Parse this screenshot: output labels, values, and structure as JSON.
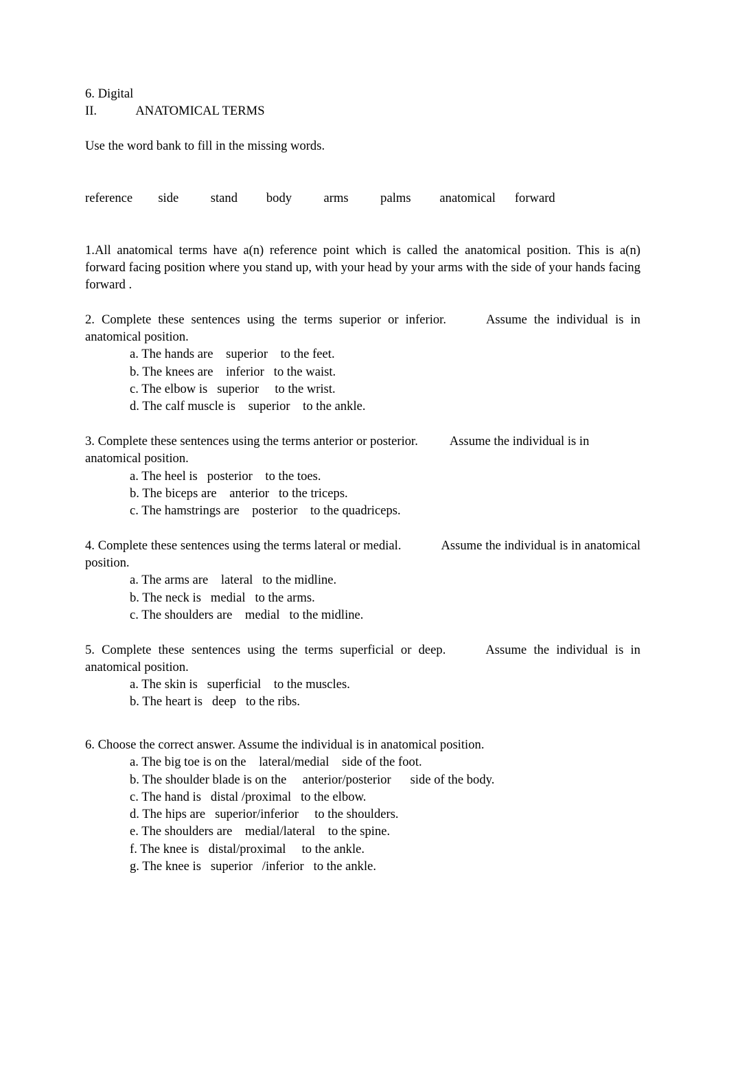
{
  "document": {
    "preceding_item": "6. Digital",
    "section": {
      "numeral": "II.",
      "title": "ANATOMICAL TERMS"
    },
    "instruction": "Use the word bank to fill in the missing words.",
    "word_bank": {
      "words": [
        "reference",
        "side",
        "stand",
        "body",
        "arms",
        "palms",
        "anatomical",
        "forward"
      ],
      "line": "reference        side          stand         body          arms          palms         anatomical      forward"
    },
    "questions": [
      {
        "number": "1.",
        "prompt": "1.All anatomical terms have a(n)     reference    point which is called the    anatomical     position. This is a(n)  forward   facing position where you    stand   up, with your  head  by your  arms   with the side of your hands facing   forward  .",
        "subitems": []
      },
      {
        "number": "2.",
        "prompt_main": "2. Complete these sentences using the terms superior or inferior.",
        "prompt_tail": "Assume the individual is in anatomical position.",
        "subitems": [
          "a. The hands are    superior    to the feet.",
          "b. The knees are    inferior   to the waist.",
          "c. The elbow is   superior     to the wrist.",
          "d. The calf muscle is    superior    to the ankle."
        ]
      },
      {
        "number": "3.",
        "prompt_main": "3. Complete these sentences using the terms anterior or posterior.",
        "prompt_tail": "Assume the individual is in anatomical position.",
        "subitems": [
          "a. The heel is   posterior    to the toes.",
          "b. The biceps are    anterior   to the triceps.",
          "c. The hamstrings are    posterior    to the quadriceps."
        ]
      },
      {
        "number": "4.",
        "prompt_main": "4. Complete these sentences using the terms lateral or medial.",
        "prompt_tail": "Assume the individual is in anatomical position.",
        "subitems": [
          "a. The arms are    lateral   to the midline.",
          "b. The neck is   medial   to the arms.",
          "c. The shoulders are    medial   to the midline."
        ]
      },
      {
        "number": "5.",
        "prompt_main": "5. Complete these sentences using the terms superficial or deep.",
        "prompt_tail": "Assume the individual is in anatomical position.",
        "subitems": [
          "a. The skin is   superficial    to the muscles.",
          "b. The heart is   deep   to the ribs."
        ]
      },
      {
        "number": "6.",
        "prompt_main": "6. Choose the correct answer. Assume the individual is in anatomical position.",
        "prompt_tail": "",
        "subitems": [
          "a. The big toe is on the    lateral/medial    side of the foot.",
          "b. The shoulder blade is on the     anterior/posterior      side of the body.",
          "c. The hand is   distal /proximal   to the elbow.",
          "d. The hips are   superior/inferior     to the shoulders.",
          "e. The shoulders are    medial/lateral    to the spine.",
          "f. The knee is   distal/proximal     to the ankle.",
          "g. The knee is   superior   /inferior   to the ankle."
        ]
      }
    ]
  }
}
